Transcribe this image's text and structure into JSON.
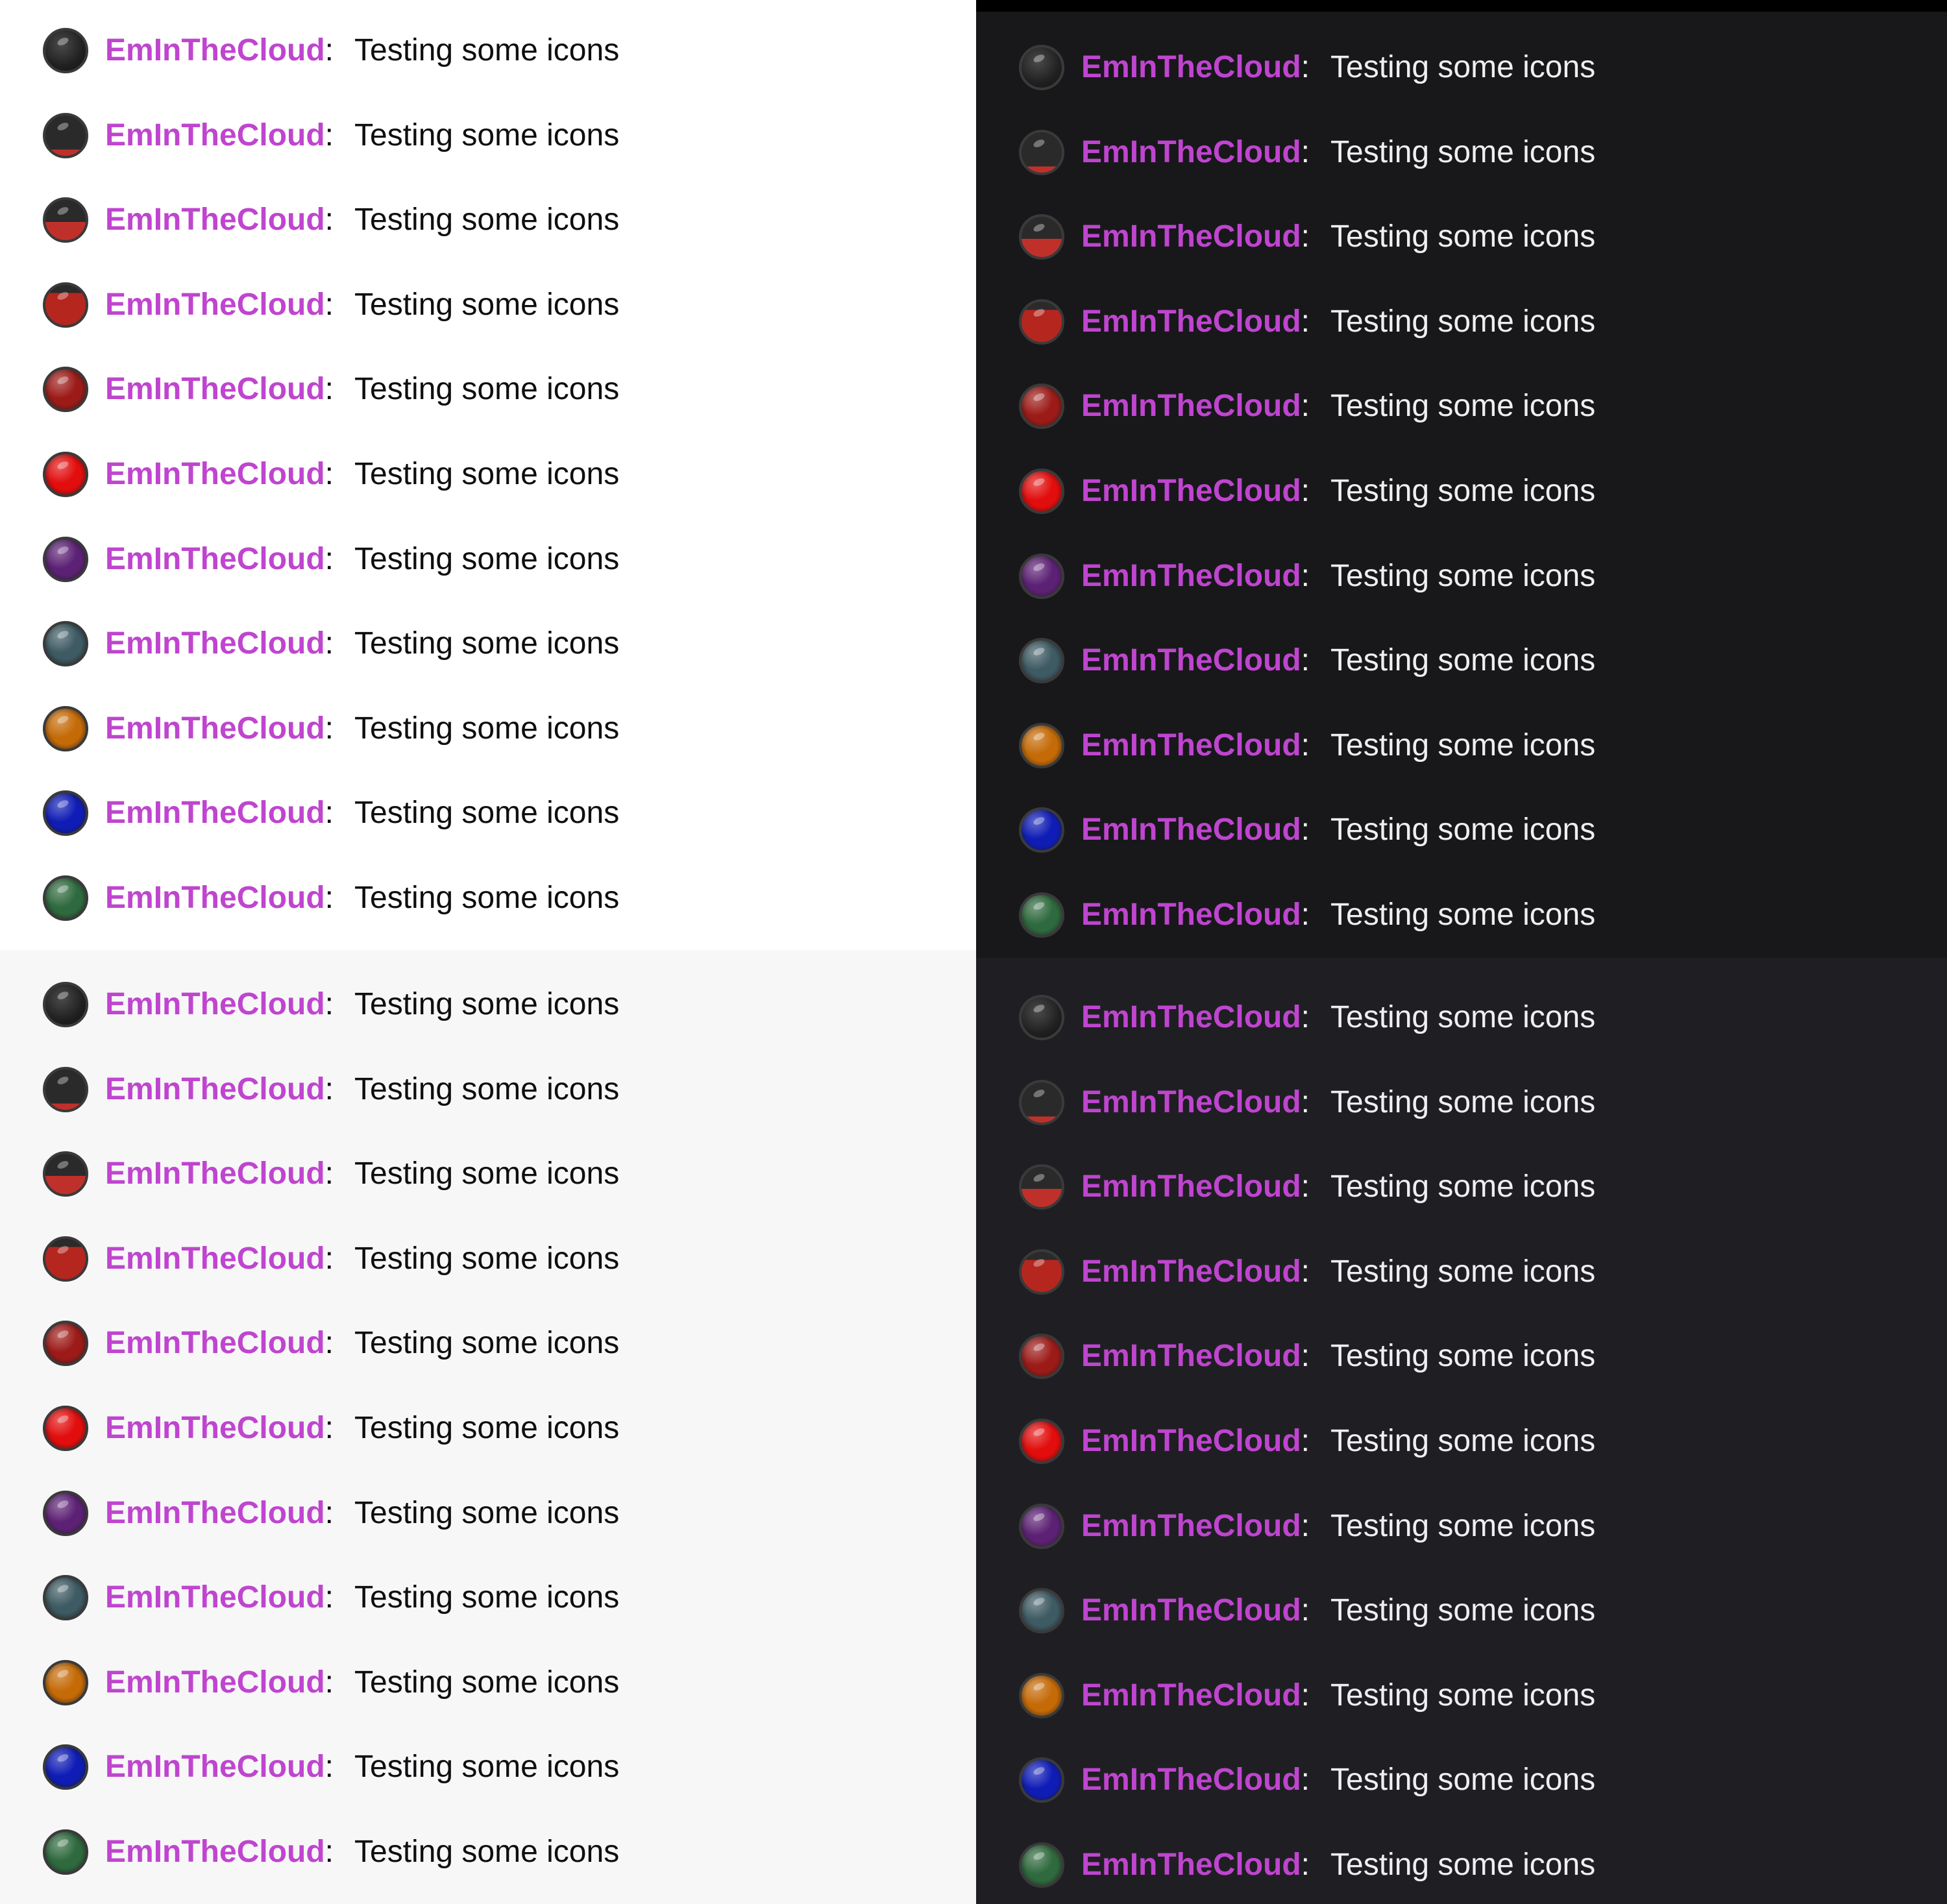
{
  "chat": {
    "username": "EmInTheCloud",
    "separator": ":",
    "message": "Testing some icons"
  },
  "themes": {
    "light": {
      "background": "#ffffff",
      "text": "#0e0e10"
    },
    "dark": {
      "background": "#18181b",
      "text": "#efeff1"
    },
    "gray": {
      "background": "#f7f7f8",
      "text": "#0e0e10"
    },
    "dark2": {
      "background": "#1f1f23",
      "text": "#efeff1"
    },
    "username_color": "#bf45cf"
  },
  "badges": [
    {
      "icon": "empty-orb-badge-icon",
      "fill": 0,
      "color": "#2a2a2a"
    },
    {
      "icon": "orb-badge-icon-1",
      "fill": 0.15,
      "color": "#c0302b"
    },
    {
      "icon": "orb-badge-icon-2",
      "fill": 0.45,
      "color": "#c0302b"
    },
    {
      "icon": "orb-badge-icon-3",
      "fill": 0.8,
      "color": "#b5261f"
    },
    {
      "icon": "dark-red-orb-badge-icon",
      "fill": 1,
      "color": "#9c1b18"
    },
    {
      "icon": "red-orb-badge-icon",
      "fill": 1,
      "color": "#e20d0d"
    },
    {
      "icon": "purple-orb-badge-icon",
      "fill": 1,
      "color": "#5c2174"
    },
    {
      "icon": "teal-orb-badge-icon",
      "fill": 1,
      "color": "#3e5a63"
    },
    {
      "icon": "orange-orb-badge-icon",
      "fill": 1,
      "color": "#c46a07"
    },
    {
      "icon": "blue-orb-badge-icon",
      "fill": 1,
      "color": "#0f1cb5"
    },
    {
      "icon": "green-orb-badge-icon",
      "fill": 1,
      "color": "#2f6a3e"
    }
  ]
}
